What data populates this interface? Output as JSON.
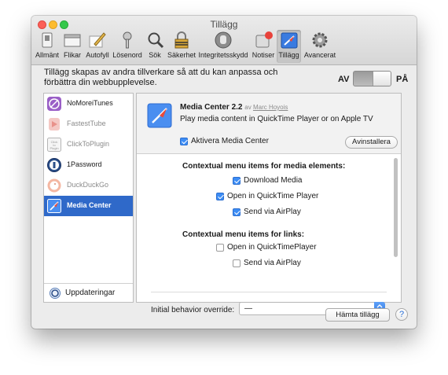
{
  "window": {
    "title": "Tillägg"
  },
  "toolbar": {
    "items": [
      {
        "label": "Allmänt",
        "icon": "general-switch-icon"
      },
      {
        "label": "Flikar",
        "icon": "tabs-icon"
      },
      {
        "label": "Autofyll",
        "icon": "pencil-icon"
      },
      {
        "label": "Lösenord",
        "icon": "key-icon"
      },
      {
        "label": "Sök",
        "icon": "search-icon"
      },
      {
        "label": "Säkerhet",
        "icon": "lock-icon"
      },
      {
        "label": "Integritetsskydd",
        "icon": "hand-icon"
      },
      {
        "label": "Notiser",
        "icon": "notification-badge-icon"
      },
      {
        "label": "Tillägg",
        "icon": "puzzle-compass-icon"
      },
      {
        "label": "Avancerat",
        "icon": "gear-icon"
      }
    ],
    "active_index": 8
  },
  "header": {
    "description": "Tillägg skapas av andra tillverkare så att du kan anpassa och förbättra din webbupplevelse.",
    "toggle_off_label": "AV",
    "toggle_on_label": "PÅ",
    "toggle_state": "on"
  },
  "extensions": [
    {
      "name": "NoMoreiTunes",
      "icon": "nomoreitunes-icon",
      "enabled": true
    },
    {
      "name": "FastestTube",
      "icon": "fastesttube-icon",
      "enabled": false
    },
    {
      "name": "ClickToPlugin",
      "icon": "clicktoplugin-icon",
      "icon_text": "Click to Plugin",
      "enabled": false
    },
    {
      "name": "1Password",
      "icon": "onepassword-icon",
      "enabled": true
    },
    {
      "name": "DuckDuckGo",
      "icon": "duckduckgo-icon",
      "enabled": false
    },
    {
      "name": "Media Center",
      "icon": "media-center-icon",
      "enabled": true,
      "selected": true
    }
  ],
  "updates_label": "Uppdateringar",
  "detail": {
    "title": "Media Center 2.2",
    "by_prefix": "av",
    "author": "Marc Hoyois",
    "description": "Play media content in QuickTime Player or on Apple TV",
    "enable_label": "Aktivera Media Center",
    "enable_checked": true,
    "uninstall_label": "Avinstallera",
    "media_section_title": "Contextual menu items for media elements:",
    "media_options": [
      {
        "label": "Download Media",
        "checked": true
      },
      {
        "label": "Open in QuickTime Player",
        "checked": true
      },
      {
        "label": "Send via AirPlay",
        "checked": true
      }
    ],
    "links_section_title": "Contextual menu items for links:",
    "link_options": [
      {
        "label": "Open in QuickTimePlayer",
        "checked": false
      },
      {
        "label": "Send via AirPlay",
        "checked": false
      }
    ],
    "override_label": "Initial behavior override:",
    "override_value": "—"
  },
  "footer": {
    "get_extensions_label": "Hämta tillägg",
    "help_label": "?"
  },
  "colors": {
    "selection": "#2f69c9",
    "checkbox": "#3d8df5",
    "window_bg": "#ececec"
  }
}
